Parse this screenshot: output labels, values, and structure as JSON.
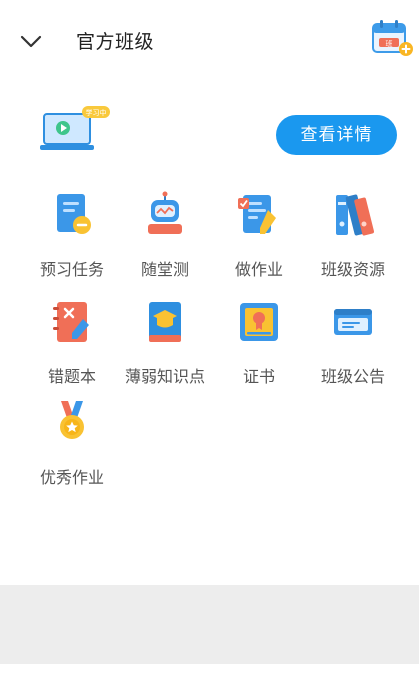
{
  "header": {
    "title": "官方班级",
    "calendar_badge": "班"
  },
  "banner": {
    "tag": "学习中",
    "button": "查看详情"
  },
  "grid": [
    {
      "label": "预习任务",
      "icon": "preview-task-icon"
    },
    {
      "label": "随堂测",
      "icon": "robot-quiz-icon"
    },
    {
      "label": "做作业",
      "icon": "homework-icon"
    },
    {
      "label": "班级资源",
      "icon": "binders-icon"
    },
    {
      "label": "错题本",
      "icon": "wrong-notebook-icon"
    },
    {
      "label": "薄弱知识点",
      "icon": "graduation-book-icon"
    },
    {
      "label": "证书",
      "icon": "certificate-icon"
    },
    {
      "label": "班级公告",
      "icon": "announcement-icon"
    },
    {
      "label": "优秀作业",
      "icon": "medal-icon"
    }
  ],
  "colors": {
    "accent": "#1a98ef",
    "footer": "#ededed"
  }
}
